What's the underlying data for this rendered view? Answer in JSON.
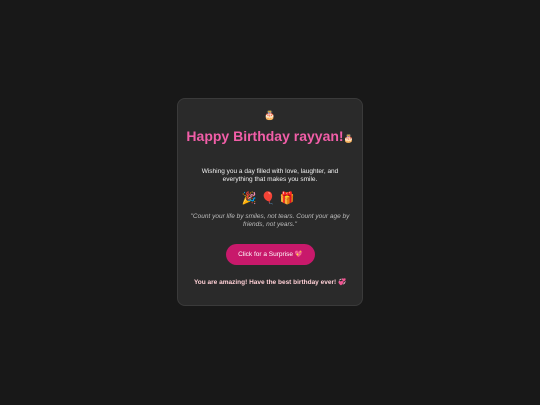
{
  "card": {
    "top_icon": "🎂",
    "title": "Happy Birthday rayyan!",
    "title_icon": "🎂",
    "wish": "Wishing you a day filled with love, laughter, and everything that makes you smile.",
    "emojis": [
      "🎉",
      "🎈",
      "🎁"
    ],
    "quote": "\"Count your life by smiles, not tears. Count your age by friends, not years.\"",
    "button_label": "Click for a Surprise 💖",
    "message": "You are amazing! Have the best birthday ever! 💞"
  },
  "colors": {
    "background": "#181818",
    "card": "#2a2a2a",
    "title": "#f25ea8",
    "button": "#c8196b",
    "message": "#ffd0d6"
  }
}
